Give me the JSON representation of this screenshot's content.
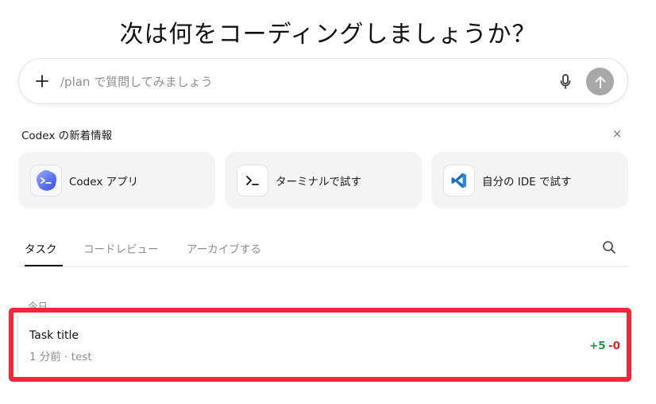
{
  "heading": "次は何をコーディングしましょうか？",
  "composer": {
    "placeholder": "/plan で質問してみましょう",
    "plus_icon": "plus-icon",
    "mic_icon": "microphone-icon",
    "send_icon": "arrow-up-icon"
  },
  "news": {
    "title": "Codex の新着情報",
    "close": "×",
    "cards": [
      {
        "label": "Codex アプリ",
        "icon": "codex-app-icon"
      },
      {
        "label": "ターミナルで試す",
        "icon": "terminal-icon"
      },
      {
        "label": "自分の IDE で試す",
        "icon": "vscode-icon"
      }
    ]
  },
  "tabs": [
    {
      "label": "タスク",
      "active": true
    },
    {
      "label": "コードレビュー",
      "active": false
    },
    {
      "label": "アーカイブする",
      "active": false
    }
  ],
  "task_group": {
    "label": "今日",
    "tasks": [
      {
        "title": "Task title",
        "meta": "1 分前 · test",
        "additions": "+5",
        "deletions": "-0"
      }
    ]
  },
  "colors": {
    "highlight": "#f0283a",
    "additions": "#1a9a3d",
    "deletions": "#e02424",
    "send_button": "#a8a8a8"
  }
}
